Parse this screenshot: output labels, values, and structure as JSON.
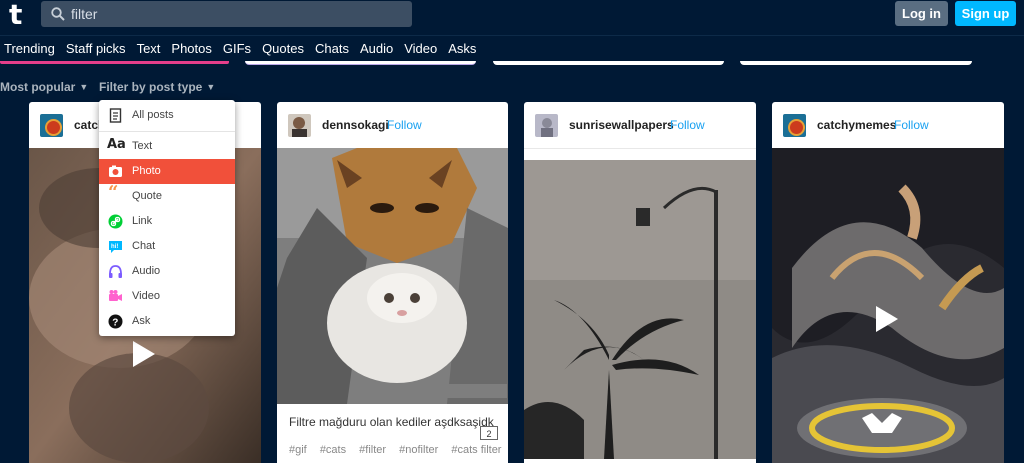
{
  "header": {
    "logo": "t",
    "search_value": "filter",
    "login_label": "Log in",
    "signup_label": "Sign up"
  },
  "tabs": [
    "Trending",
    "Staff picks",
    "Text",
    "Photos",
    "GIFs",
    "Quotes",
    "Chats",
    "Audio",
    "Video",
    "Asks"
  ],
  "filters": {
    "sort_label": "Most popular",
    "type_label": "Filter by post type"
  },
  "dropdown": {
    "items": [
      {
        "label": "All posts",
        "icon": "all-posts-icon"
      },
      {
        "label": "Text",
        "icon": "text-icon"
      },
      {
        "label": "Photo",
        "icon": "camera-icon"
      },
      {
        "label": "Quote",
        "icon": "quote-icon"
      },
      {
        "label": "Link",
        "icon": "link-icon"
      },
      {
        "label": "Chat",
        "icon": "chat-icon"
      },
      {
        "label": "Audio",
        "icon": "headphones-icon"
      },
      {
        "label": "Video",
        "icon": "video-camera-icon"
      },
      {
        "label": "Ask",
        "icon": "question-icon"
      }
    ],
    "selected": "Photo"
  },
  "posts": [
    {
      "author": "catch",
      "follow": "",
      "media": "video"
    },
    {
      "author": "dennsokagi",
      "follow": "Follow",
      "media": "gif",
      "gif_count": "2",
      "caption": "Filtre mağduru olan kediler aşdksaşidk",
      "tags": [
        "#gif",
        "#cats",
        "#filter",
        "#nofilter",
        "#cats filter"
      ]
    },
    {
      "author": "sunrisewallpapers",
      "follow": "Follow",
      "media": "photo"
    },
    {
      "author": "catchymemes",
      "follow": "Follow",
      "media": "video"
    }
  ],
  "colors": {
    "background": "#001935",
    "accent_blue": "#00b8ff",
    "active_item": "#f1503a",
    "follow_link": "#1aa1f0",
    "trending_underline": "#e53e8a"
  }
}
